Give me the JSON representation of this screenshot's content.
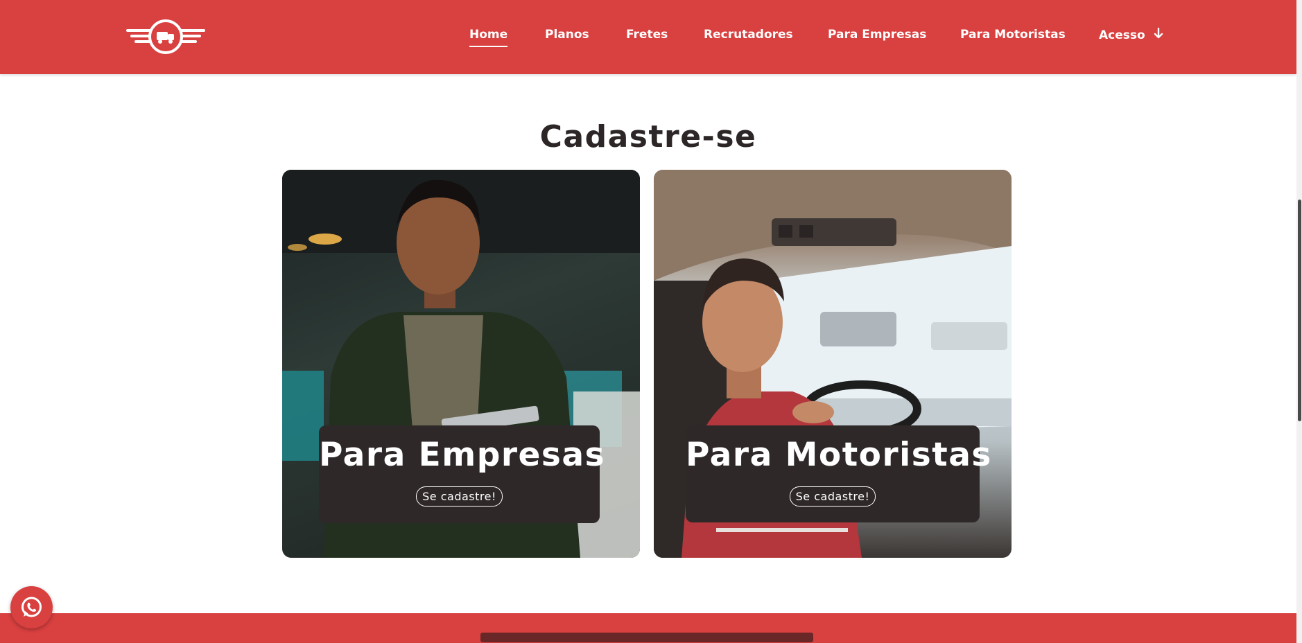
{
  "header": {
    "logo_icon": "truck-wings-logo-icon",
    "nav": [
      {
        "label": "Home",
        "active": true
      },
      {
        "label": "Planos"
      },
      {
        "label": "Fretes"
      },
      {
        "label": "Recrutadores"
      },
      {
        "label": "Para Empresas"
      },
      {
        "label": "Para Motoristas"
      },
      {
        "label": "Acesso",
        "icon": "arrow-down-icon"
      }
    ]
  },
  "section": {
    "title": "Cadastre-se",
    "cards": [
      {
        "title": "Para Empresas",
        "button": "Se cadastre!",
        "image": "man-with-tablet-photo"
      },
      {
        "title": "Para Motoristas",
        "button": "Se cadastre!",
        "image": "truck-driver-photo"
      }
    ]
  },
  "floating": {
    "whatsapp_icon": "whatsapp-icon"
  },
  "colors": {
    "brand_red": "#d94040",
    "caption_bg": "#2e2829",
    "title_text": "#2c2626"
  }
}
